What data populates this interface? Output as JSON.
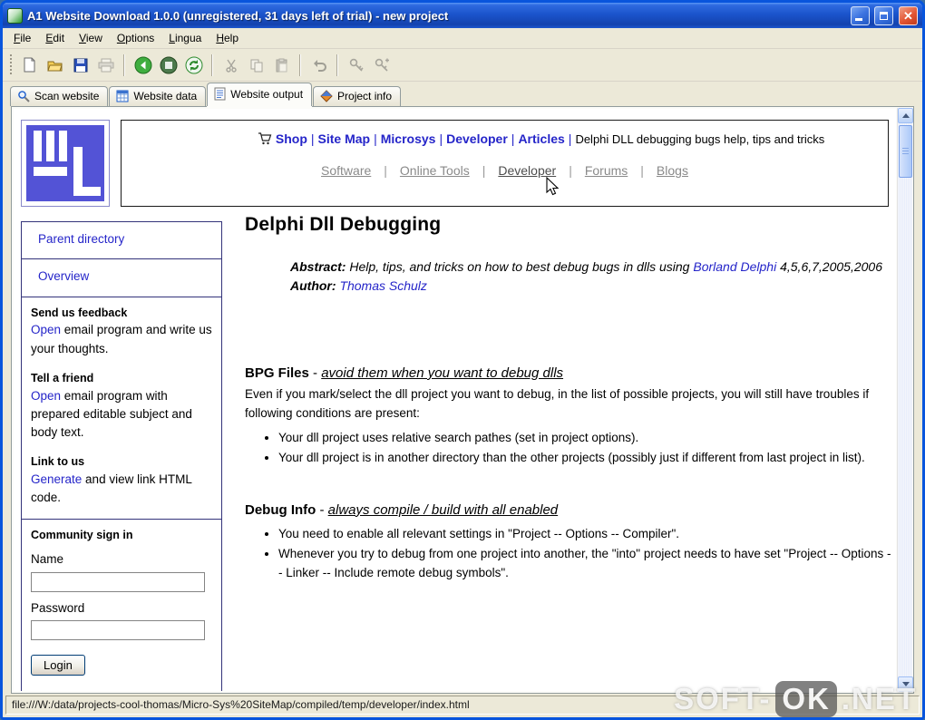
{
  "window": {
    "title": "A1 Website Download 1.0.0 (unregistered, 31 days left of trial) - new project"
  },
  "menu": {
    "items": [
      "File",
      "Edit",
      "View",
      "Options",
      "Lingua",
      "Help"
    ]
  },
  "toolbar": {
    "buttons": [
      "new",
      "open",
      "save",
      "print",
      "back",
      "stop",
      "refresh",
      "cut",
      "copy",
      "paste",
      "undo",
      "find",
      "find-next"
    ]
  },
  "tabs": {
    "scan": "Scan website",
    "data": "Website data",
    "output": "Website output",
    "info": "Project info",
    "active": "Website output"
  },
  "nav": {
    "sep": "|",
    "links1": [
      "Shop",
      "Site Map",
      "Microsys",
      "Developer",
      "Articles"
    ],
    "tagline": "Delphi DLL debugging bugs help, tips and tricks",
    "links2": [
      "Software",
      "Online Tools",
      "Developer",
      "Forums",
      "Blogs"
    ],
    "hovered_link": "Developer"
  },
  "sidebar": {
    "parent": "Parent directory",
    "overview": "Overview",
    "feedback_title": "Send us feedback",
    "feedback_link": "Open",
    "feedback_rest": " email program and write us your thoughts.",
    "tell_title": "Tell a friend",
    "tell_link": "Open",
    "tell_rest": " email program with prepared editable subject and body text.",
    "linkus_title": "Link to us",
    "linkus_link": "Generate",
    "linkus_rest": " and view link HTML code.",
    "community_title": "Community sign in",
    "name_label": "Name",
    "password_label": "Password",
    "login_button": "Login"
  },
  "article": {
    "title": "Delphi Dll Debugging",
    "abstract_label": "Abstract:",
    "abstract_text": " Help, tips, and tricks on how to best debug bugs in dlls using ",
    "abstract_link": "Borland Delphi",
    "abstract_versions": " 4,5,6,7,2005,2006",
    "author_label": "Author:",
    "author_link": "Thomas Schulz",
    "bpg_title": "BPG Files",
    "bpg_dash": " - ",
    "bpg_subtitle": "avoid them when you want to debug dlls",
    "bpg_intro": "Even if you mark/select the dll project you want to debug, in the list of possible projects, you will still have troubles if following conditions are present:",
    "bpg_bullets": [
      "Your dll project uses relative search pathes (set in project options).",
      "Your dll project is in another directory than the other projects (possibly just if different from last project in list)."
    ],
    "debug_title": "Debug Info",
    "debug_dash": " - ",
    "debug_subtitle": "always compile / build with all enabled",
    "debug_bullets": [
      "You need to enable all relevant settings in \"Project -- Options -- Compiler\".",
      "Whenever you try to debug from one project into another, the \"into\" project needs to have set \"Project -- Options -- Linker -- Include remote debug symbols\"."
    ]
  },
  "statusbar": {
    "url": "file:///W:/data/projects-cool-thomas/Micro-Sys%20SiteMap/compiled/temp/developer/index.html"
  },
  "watermark": {
    "prefix": "SOFT-",
    "badge": "OK",
    "suffix": ".NET"
  },
  "colors": {
    "titlebar_blue": "#1b54cc",
    "window_border": "#0855DD",
    "chrome_beige": "#ECE9D8",
    "link_blue": "#2525c9",
    "gray_link": "#8a8a8a"
  }
}
